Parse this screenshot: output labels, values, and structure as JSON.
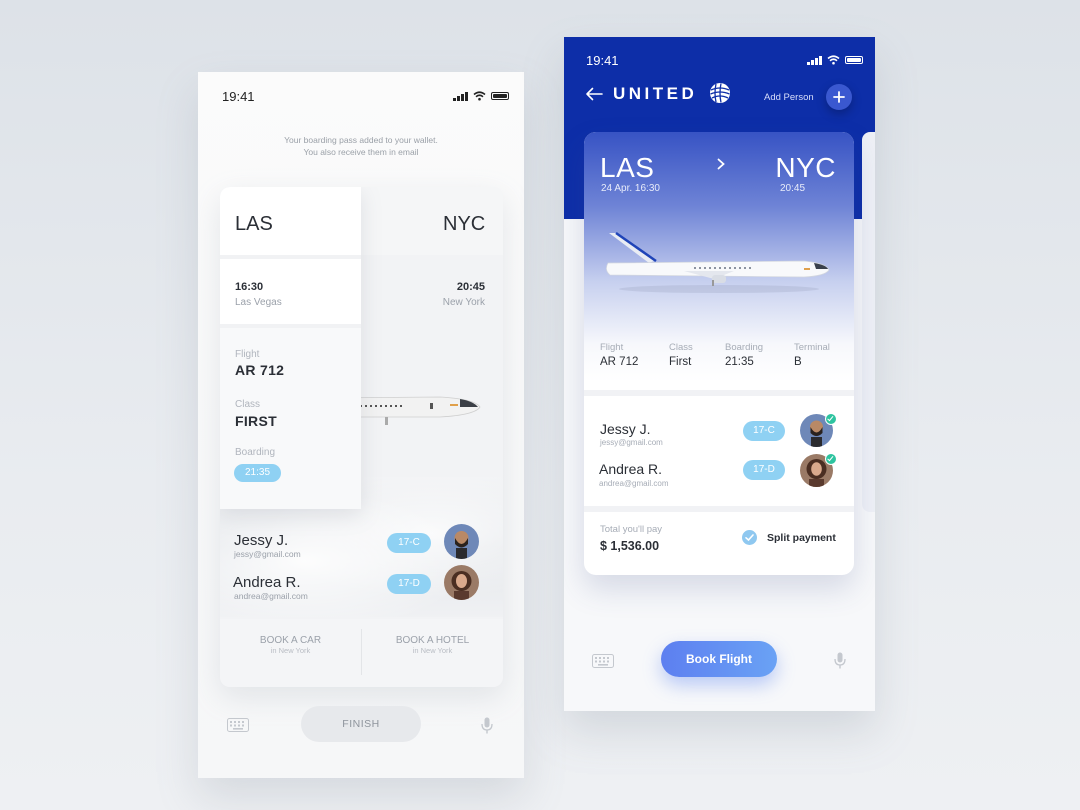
{
  "left_phone": {
    "status_time": "19:41",
    "notice_line1": "Your boarding pass added to your wallet.",
    "notice_line2": "You also receive them in email",
    "origin": "LAS",
    "destination": "NYC",
    "depart_time": "16:30",
    "depart_city": "Las Vegas",
    "arrive_time": "20:45",
    "arrive_city": "New York",
    "flight_label": "Flight",
    "flight_value": "AR 712",
    "class_label": "Class",
    "class_value": "FIRST",
    "boarding_label": "Boarding",
    "boarding_value": "21:35",
    "passengers": [
      {
        "name": "Jessy J.",
        "email": "jessy@gmail.com",
        "seat": "17-C"
      },
      {
        "name": "Andrea R.",
        "email": "andrea@gmail.com",
        "seat": "17-D"
      }
    ],
    "book_car": "BOOK A CAR",
    "book_car_sub": "in New York",
    "book_hotel": "BOOK A HOTEL",
    "book_hotel_sub": "in New York",
    "finish_label": "FINISH"
  },
  "right_phone": {
    "status_time": "19:41",
    "brand": "UNITED",
    "add_person_label": "Add Person",
    "origin": "LAS",
    "origin_datetime": "24 Apr. 16:30",
    "destination": "NYC",
    "arrive_time": "20:45",
    "details": [
      {
        "label": "Flight",
        "value": "AR 712"
      },
      {
        "label": "Class",
        "value": "First"
      },
      {
        "label": "Boarding",
        "value": "21:35"
      },
      {
        "label": "Terminal",
        "value": "B"
      }
    ],
    "passengers": [
      {
        "name": "Jessy J.",
        "email": "jessy@gmail.com",
        "seat": "17-C"
      },
      {
        "name": "Andrea R.",
        "email": "andrea@gmail.com",
        "seat": "17-D"
      }
    ],
    "total_label": "Total you'll pay",
    "total_value": "$ 1,536.00",
    "split_payment_label": "Split payment",
    "book_flight_label": "Book Flight"
  },
  "colors": {
    "united_blue": "#0d2ea8",
    "seat_pill": "#8fd1f3",
    "button_gradient_start": "#5d7ff0",
    "button_gradient_end": "#6aa2f5",
    "check_green": "#2ec4a0"
  },
  "icons": [
    "signal-icon",
    "wifi-icon",
    "battery-icon",
    "back-arrow-icon",
    "united-globe-logo",
    "plus-icon",
    "chevron-right-icon",
    "keyboard-icon",
    "microphone-icon",
    "check-icon"
  ]
}
